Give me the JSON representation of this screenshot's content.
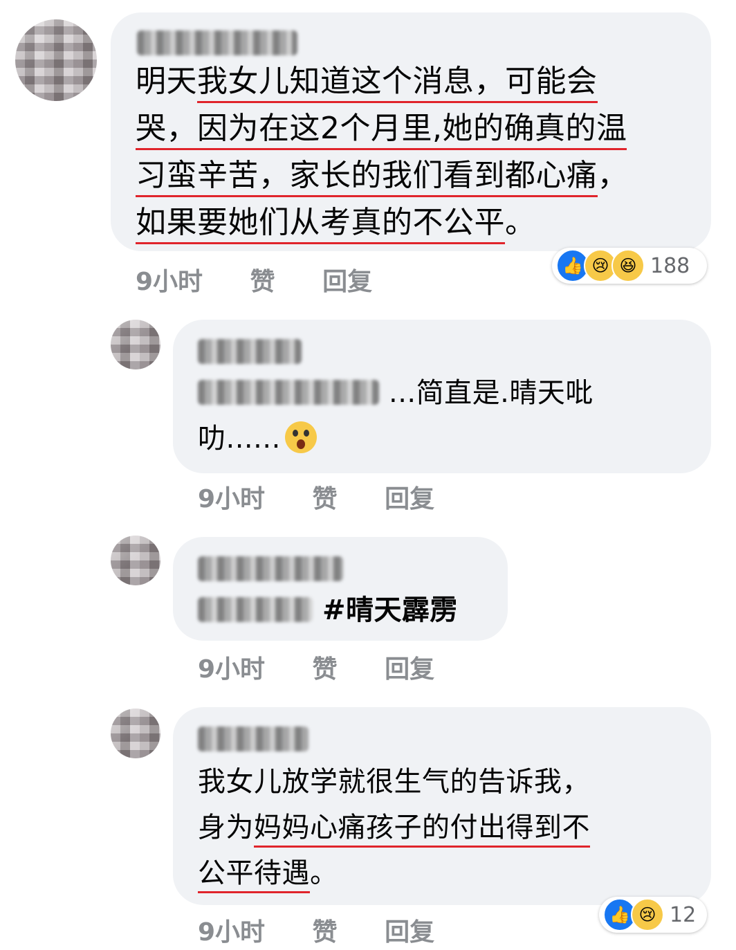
{
  "comments": [
    {
      "lines": [
        {
          "pre": "明天",
          "ul": "我女儿知道这个消息，可能会",
          "post": ""
        },
        {
          "pre": "",
          "ul": "哭，因为在这2个月里,她的确真的温",
          "post": ""
        },
        {
          "pre": "",
          "ul": "习蛮辛苦，家长的我们看到都心痛",
          "post": "，"
        },
        {
          "pre": "",
          "ul": "如果要她们从考真的不公平",
          "post": "。"
        }
      ],
      "time": "9小时",
      "like": "赞",
      "reply": "回复",
      "reactions": {
        "icons": [
          "like-icon",
          "sad-icon",
          "haha-icon"
        ],
        "count": "188"
      }
    },
    {
      "text_line1": "...简直是.晴天吡",
      "text_line2": "叻......",
      "emoji": "wow-icon",
      "time": "9小时",
      "like": "赞",
      "reply": "回复"
    },
    {
      "hashtag": "#晴天霹雳",
      "time": "9小时",
      "like": "赞",
      "reply": "回复"
    },
    {
      "lines": [
        {
          "pre": "我女儿放学就很生气的告诉我，",
          "ul": "",
          "post": ""
        },
        {
          "pre": "身为",
          "ul": "妈妈心痛孩子的付出得到不",
          "post": ""
        },
        {
          "pre": "",
          "ul": "公平待遇",
          "post": "。"
        }
      ],
      "time": "9小时",
      "like": "赞",
      "reply": "回复",
      "reactions": {
        "icons": [
          "like-icon",
          "sad-icon"
        ],
        "count": "12"
      }
    }
  ],
  "colors": {
    "bubble": "#f0f2f5",
    "underline": "#e0242b",
    "meta": "#8a8d91",
    "like": "#1877f2"
  }
}
